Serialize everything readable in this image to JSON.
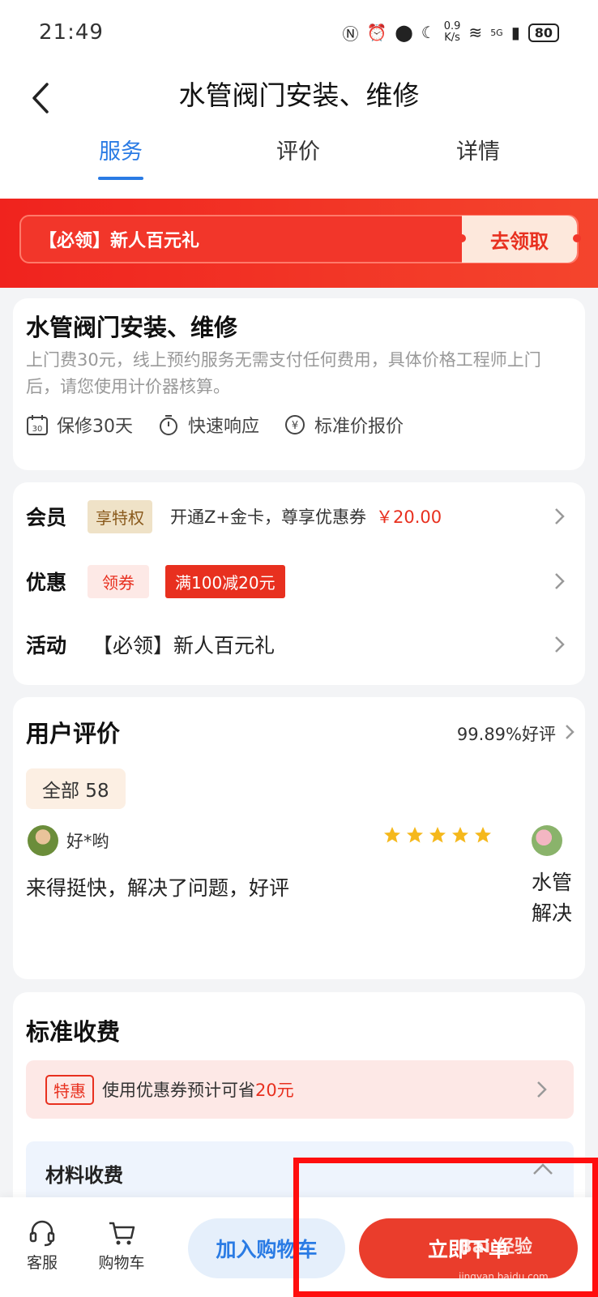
{
  "status": {
    "time": "21:49",
    "speed_top": "0.9",
    "speed_unit": "K/s",
    "network": "5G",
    "battery": "80"
  },
  "header": {
    "title": "水管阀门安装、维修",
    "tabs": [
      "服务",
      "评价",
      "详情"
    ]
  },
  "promo": {
    "text": "【必领】新人百元礼",
    "claim_label": "去领取"
  },
  "service": {
    "title": "水管阀门安装、维修",
    "description": "上门费30元，线上预约服务无需支付任何费用，具体价格工程师上门后，请您使用计价器核算。",
    "tags": [
      "保修30天",
      "快速响应",
      "标准价报价"
    ],
    "warranty_icon_text": "30"
  },
  "perks": {
    "member_label": "会员",
    "member_badge": "享特权",
    "member_text": "开通Z+金卡，尊享优惠券",
    "member_price": "￥20.00",
    "discount_label": "优惠",
    "coupon_get": "领券",
    "coupon_tag": "满100减20元",
    "activity_label": "活动",
    "activity_text": "【必领】新人百元礼"
  },
  "reviews": {
    "title": "用户评价",
    "rate": "99.89%好评",
    "filter": "全部 58",
    "items": [
      {
        "name": "好*哟",
        "text": "来得挺快，解决了问题，好评",
        "stars": 5
      },
      {
        "text": "水管\n解决"
      }
    ]
  },
  "fees": {
    "title": "标准收费",
    "special_badge": "特惠",
    "saving_text": "使用优惠券预计可省",
    "saving_amount": "20元",
    "materials_title": "材料收费"
  },
  "bottom_bar": {
    "service_label": "客服",
    "cart_label": "购物车",
    "add_cart": "加入购物车",
    "order_now": "立即下单"
  },
  "watermark": {
    "text": "Bai 经验",
    "sub": "jingyan.baidu.com"
  },
  "colors": {
    "accent_blue": "#2a7be4",
    "accent_red": "#e8301f",
    "highlight": "#ff0e0e"
  }
}
